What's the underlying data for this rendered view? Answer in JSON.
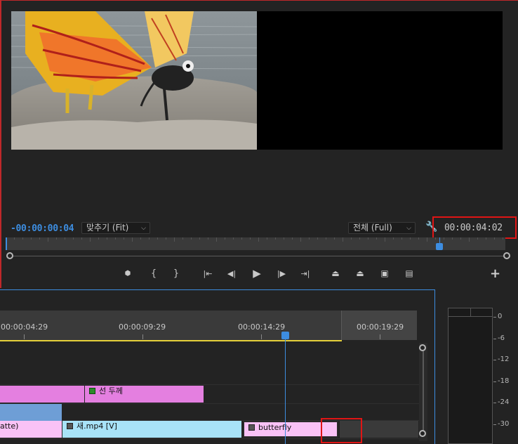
{
  "monitor": {
    "current_timecode": "-00:00:00:04",
    "zoom_select": "맞추기 (Fit)",
    "quality_select": "전체 (Full)",
    "duration_timecode": "00:00:04:02",
    "settings_icon": "wrench-icon",
    "transport": [
      {
        "name": "add-marker-button",
        "icon": "marker-icon",
        "glyph": "⬢"
      },
      {
        "name": "mark-in-button",
        "icon": "mark-in-icon",
        "glyph": "{"
      },
      {
        "name": "mark-out-button",
        "icon": "mark-out-icon",
        "glyph": "}"
      },
      {
        "name": "go-to-in-button",
        "icon": "go-to-in-icon",
        "glyph": "|←"
      },
      {
        "name": "step-back-button",
        "icon": "step-back-icon",
        "glyph": "◀|"
      },
      {
        "name": "play-button",
        "icon": "play-icon",
        "glyph": "▶"
      },
      {
        "name": "step-forward-button",
        "icon": "step-forward-icon",
        "glyph": "|▶"
      },
      {
        "name": "go-to-out-button",
        "icon": "go-to-out-icon",
        "glyph": "→|"
      },
      {
        "name": "lift-button",
        "icon": "lift-icon",
        "glyph": "⏏"
      },
      {
        "name": "extract-button",
        "icon": "extract-icon",
        "glyph": "⏏"
      },
      {
        "name": "export-frame-button",
        "icon": "camera-icon",
        "glyph": "📷"
      },
      {
        "name": "compare-view-button",
        "icon": "film-icon",
        "glyph": "🎞"
      }
    ],
    "add_button": "+"
  },
  "timeline": {
    "ruler_labels": [
      "00:00:04:29",
      "00:00:09:29",
      "00:00:14:29",
      "00:00:19:29"
    ],
    "clips": {
      "title_clip": "선 두께",
      "matte_clip": "atte)",
      "video_clip": "새.mp4 [V]",
      "butterfly_clip": "butterfly"
    }
  },
  "audio_meter": {
    "labels": [
      "0",
      "-6",
      "-12",
      "-18",
      "-24",
      "-30"
    ]
  },
  "colors": {
    "accent": "#3d8de0",
    "highlight": "#e01515",
    "work_area": "#e5d03a",
    "clip_pink": "#e47fe0",
    "clip_light_pink": "#f9c2f6",
    "clip_cyan": "#a8e3f8",
    "clip_blue": "#6e9ed6"
  }
}
